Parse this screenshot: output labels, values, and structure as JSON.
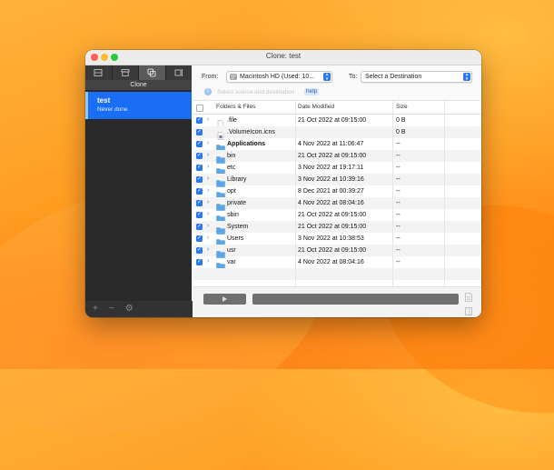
{
  "window": {
    "title": "Clone: test"
  },
  "sidebar": {
    "tabs": [
      {
        "name": "tab-tasks",
        "icon": "list-icon"
      },
      {
        "name": "tab-archive",
        "icon": "archive-icon"
      },
      {
        "name": "tab-clone",
        "icon": "clone-icon",
        "active": true
      },
      {
        "name": "tab-restore",
        "icon": "restore-icon"
      }
    ],
    "section_label": "Clone",
    "task": {
      "name": "test",
      "status": "Never done"
    },
    "bottom": {
      "add": "+",
      "remove": "−",
      "settings": "⚙"
    }
  },
  "toolbar": {
    "from_label": "From:",
    "from_value": "Macintosh HD (Used: 10...",
    "to_label": "To:",
    "to_value": "Select a Destination"
  },
  "info": {
    "text": "Select source and destination",
    "help": "help"
  },
  "table": {
    "columns": [
      "Folders & Files",
      "Date Modified",
      "Size"
    ],
    "rows": [
      {
        "name": ".file",
        "date": "21 Oct 2022 at 09:15:00",
        "size": "0 B",
        "kind": "file"
      },
      {
        "name": ".VolumeIcon.icns",
        "date": "",
        "size": "0 B",
        "kind": "icns"
      },
      {
        "name": "Applications",
        "date": "4 Nov 2022 at 11:06:47",
        "size": "--",
        "kind": "folder",
        "bold": true
      },
      {
        "name": "bin",
        "date": "21 Oct 2022 at 09:15:00",
        "size": "--",
        "kind": "folder"
      },
      {
        "name": "etc",
        "date": "3 Nov 2022 at 19:17:11",
        "size": "--",
        "kind": "folder"
      },
      {
        "name": "Library",
        "date": "3 Nov 2022 at 10:39:16",
        "size": "--",
        "kind": "folder"
      },
      {
        "name": "opt",
        "date": "8 Dec 2021 at 00:39:27",
        "size": "--",
        "kind": "folder"
      },
      {
        "name": "private",
        "date": "4 Nov 2022 at 08:04:16",
        "size": "--",
        "kind": "folder"
      },
      {
        "name": "sbin",
        "date": "21 Oct 2022 at 09:15:00",
        "size": "--",
        "kind": "folder"
      },
      {
        "name": "System",
        "date": "21 Oct 2022 at 09:15:00",
        "size": "--",
        "kind": "folder"
      },
      {
        "name": "Users",
        "date": "3 Nov 2022 at 10:38:53",
        "size": "--",
        "kind": "folder"
      },
      {
        "name": "usr",
        "date": "21 Oct 2022 at 09:15:00",
        "size": "--",
        "kind": "folder"
      },
      {
        "name": "var",
        "date": "4 Nov 2022 at 08:04:16",
        "size": "--",
        "kind": "folder"
      }
    ]
  },
  "colors": {
    "accent": "#2a78f4",
    "folder": "#5aa7e8",
    "selected_task": "#1a6ef5"
  }
}
